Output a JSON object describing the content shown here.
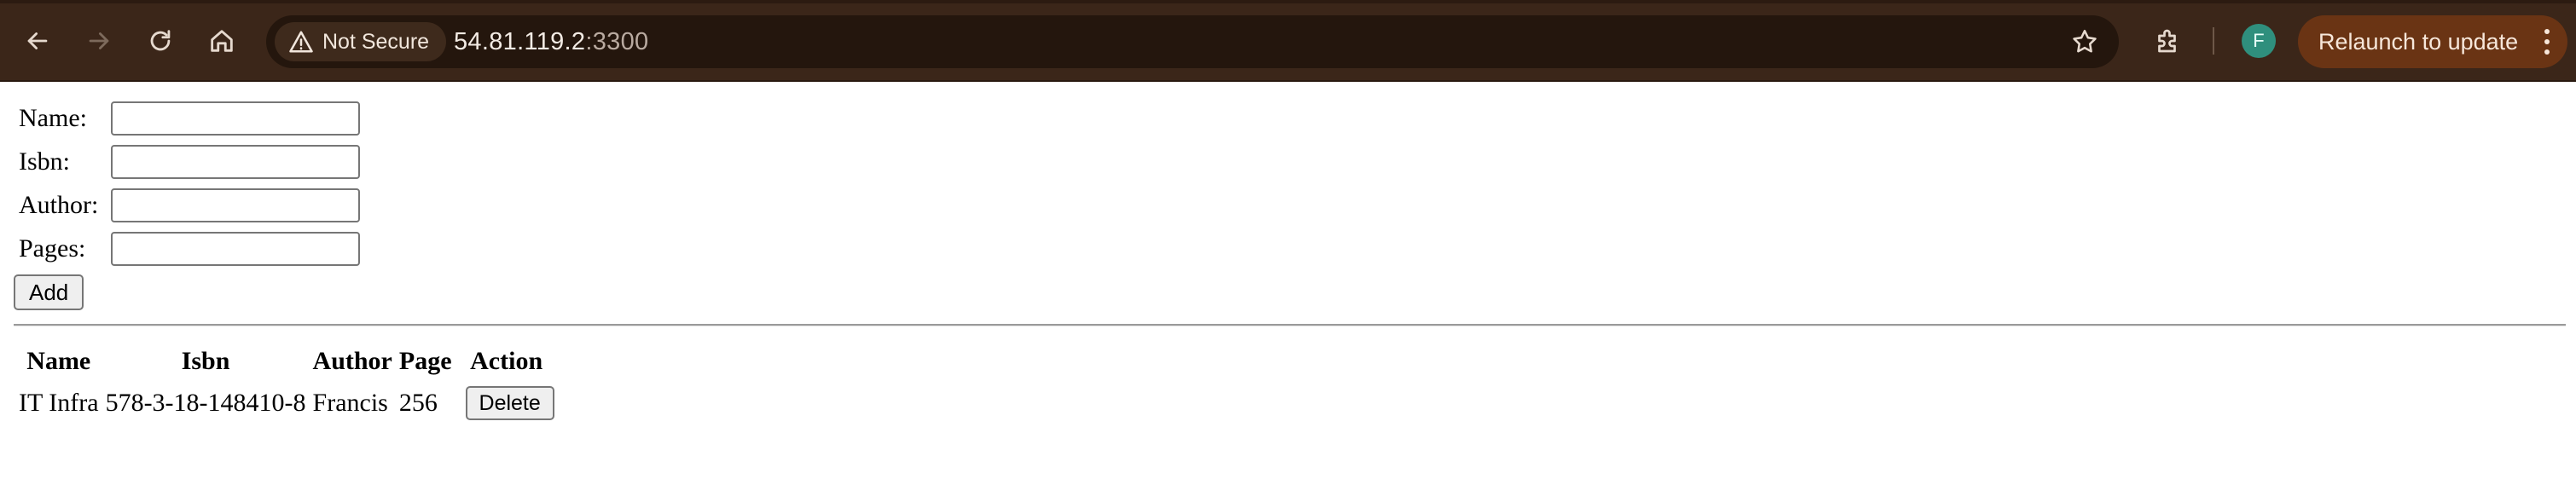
{
  "browser": {
    "security_label": "Not Secure",
    "url_host": "54.81.119.2",
    "url_port": ":3300",
    "profile_initial": "F",
    "relaunch_label": "Relaunch to update"
  },
  "form": {
    "name_label": "Name:",
    "isbn_label": "Isbn:",
    "author_label": "Author:",
    "pages_label": "Pages:",
    "name_value": "",
    "isbn_value": "",
    "author_value": "",
    "pages_value": "",
    "add_label": "Add"
  },
  "table": {
    "headers": [
      "Name",
      "Isbn",
      "Author",
      "Page",
      "Action"
    ],
    "rows": [
      {
        "name": "IT Infra",
        "isbn": "578-3-18-148410-8",
        "author": "Francis",
        "pages": "256",
        "action_label": "Delete"
      }
    ]
  }
}
